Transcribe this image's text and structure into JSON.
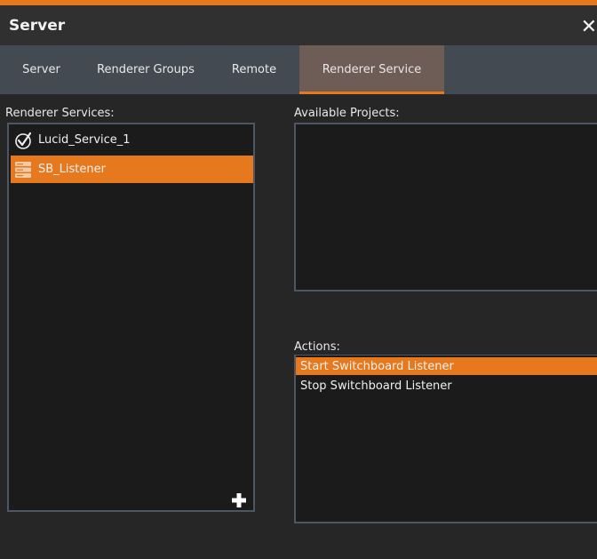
{
  "window": {
    "title": "Server",
    "close_symbol": "✕"
  },
  "tabs": [
    {
      "label": "Server"
    },
    {
      "label": "Renderer Groups"
    },
    {
      "label": "Remote"
    },
    {
      "label": "Renderer Service",
      "active": true
    }
  ],
  "renderer_services": {
    "label": "Renderer Services:",
    "items": [
      {
        "name": "Lucid_Service_1",
        "icon": "check-circle-icon",
        "selected": false
      },
      {
        "name": "SB_Listener",
        "icon": "server-icon",
        "selected": true
      }
    ],
    "add_symbol": "+"
  },
  "available_projects": {
    "label": "Available Projects:",
    "items": []
  },
  "actions": {
    "label": "Actions:",
    "items": [
      {
        "label": "Start Switchboard Listener",
        "selected": true
      },
      {
        "label": "Stop Switchboard Listener",
        "selected": false
      }
    ]
  },
  "colors": {
    "accent": "#e6781e",
    "tab_active_bg": "#6d5d56",
    "tab_bar_bg": "#444a52",
    "panel_bg": "#1b1b1b",
    "panel_border": "#4d5763"
  }
}
